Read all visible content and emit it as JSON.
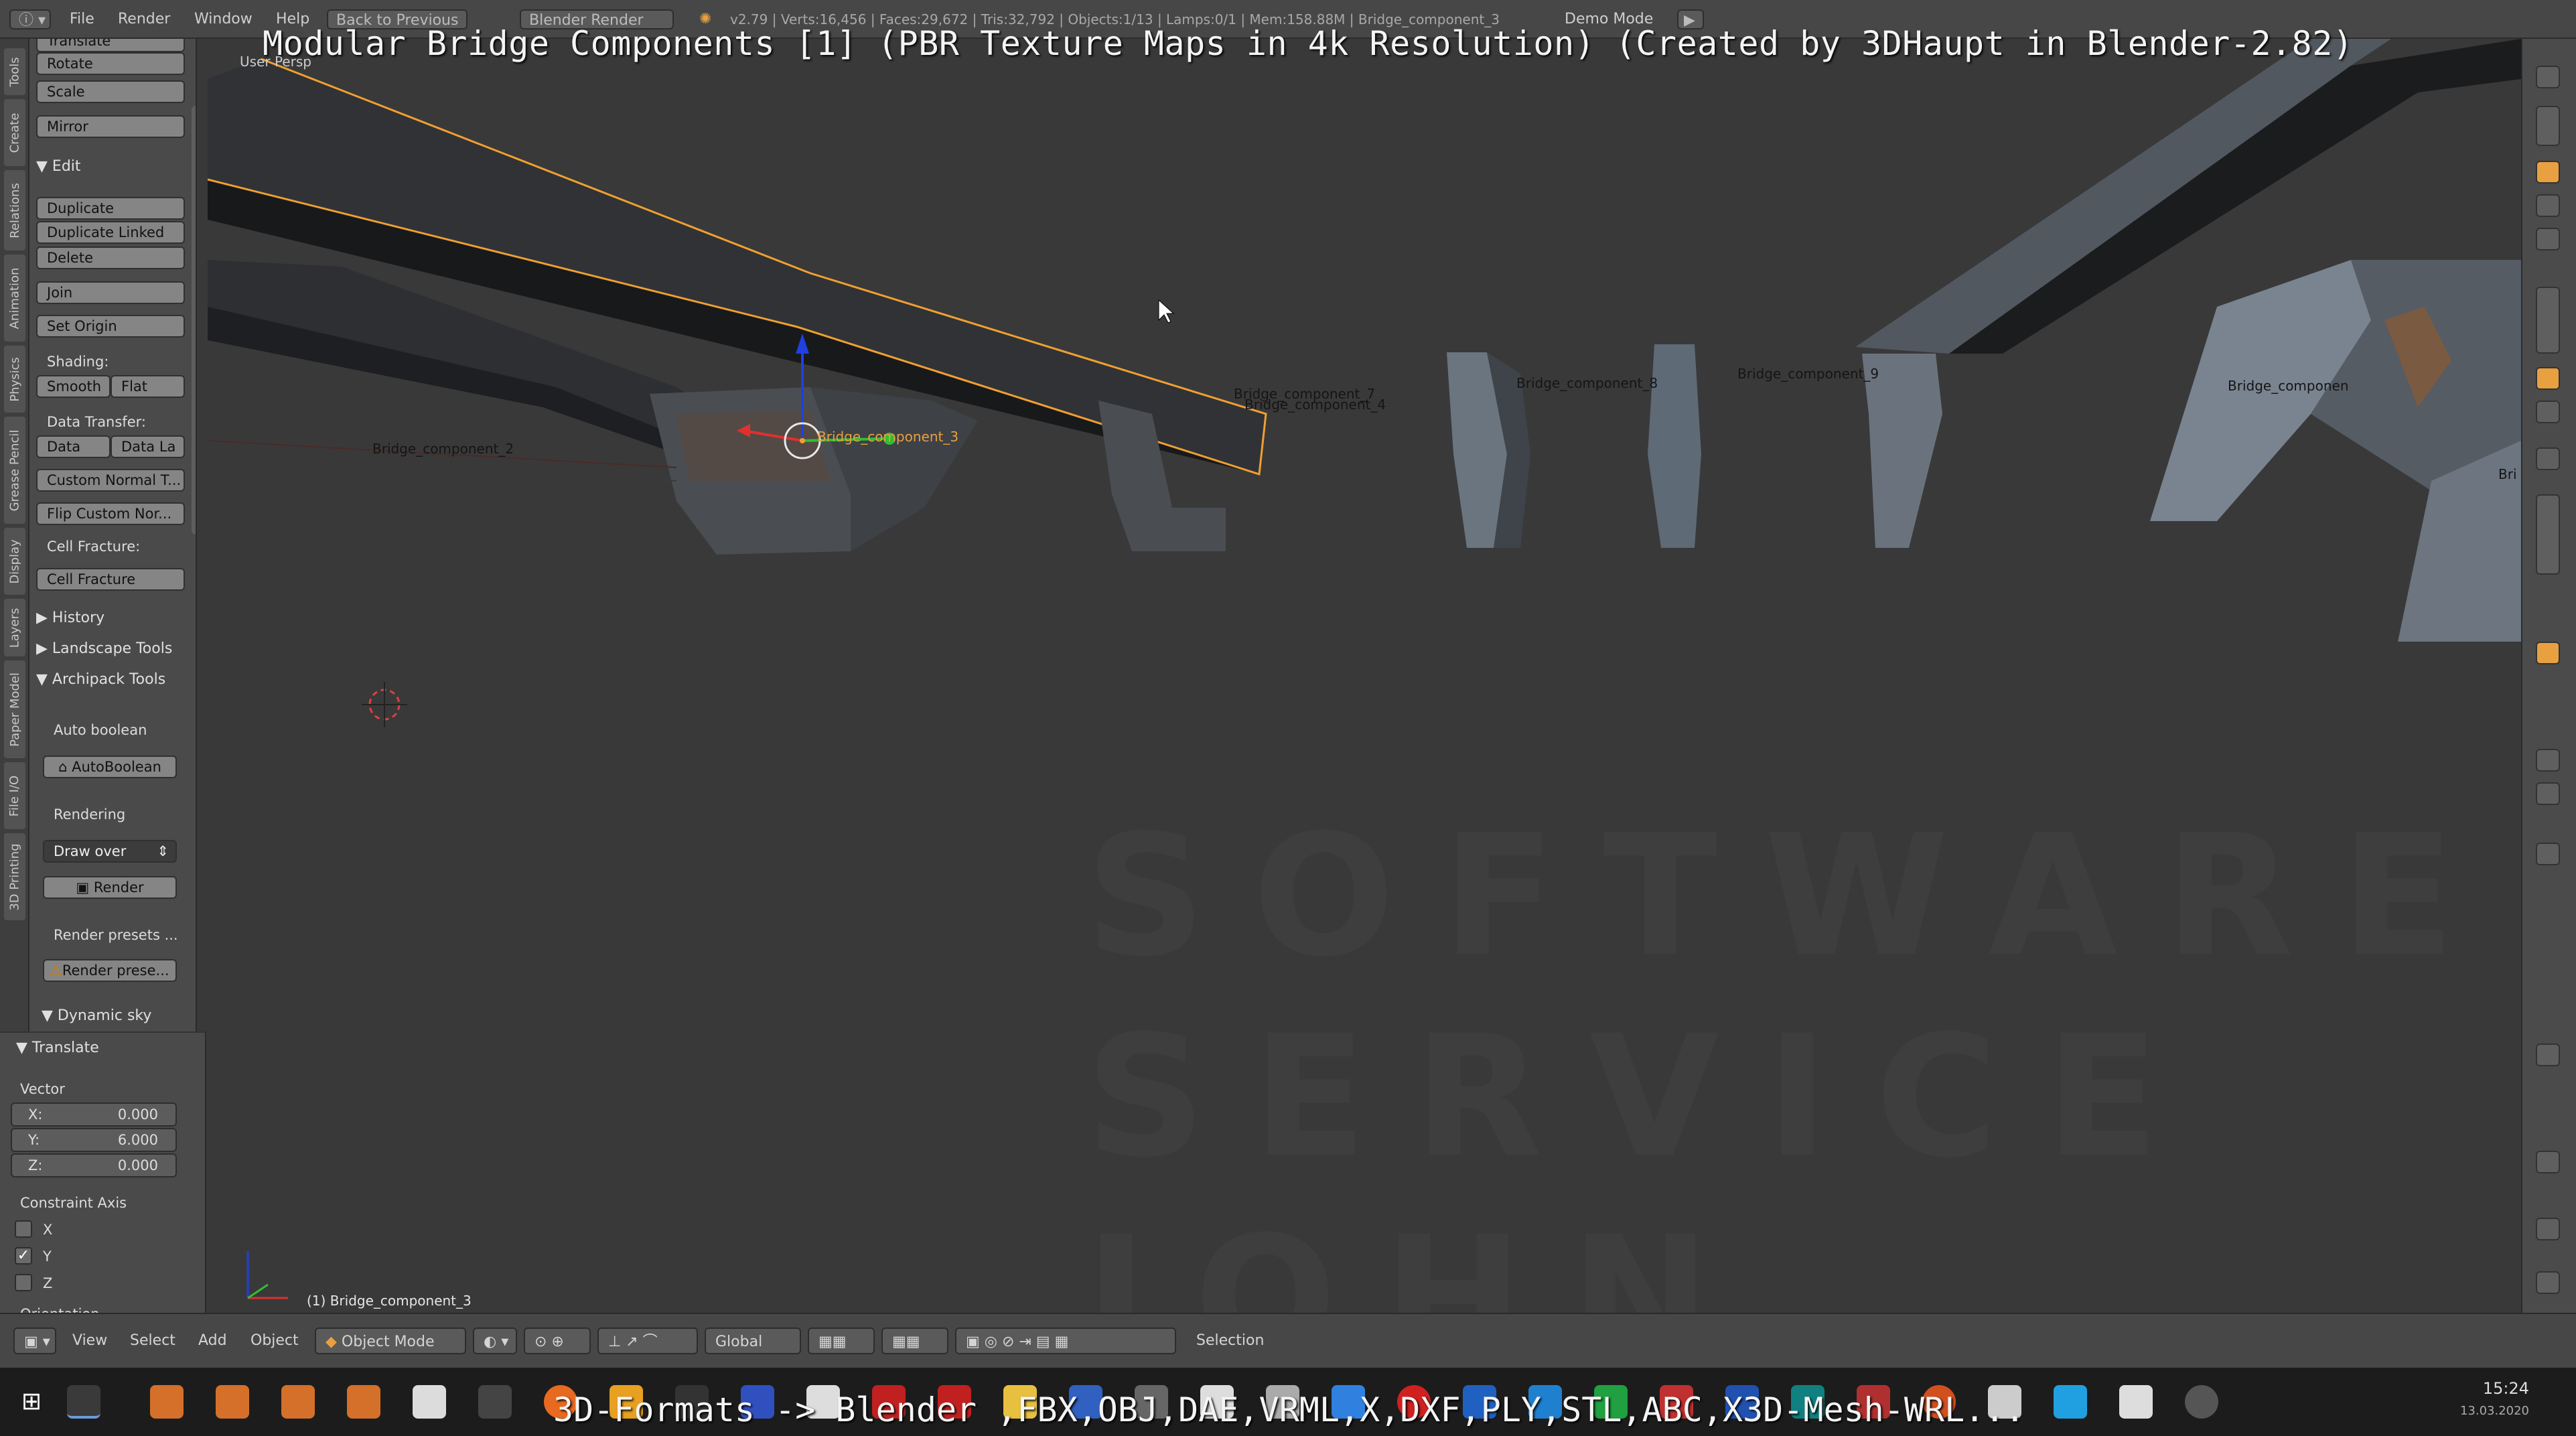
{
  "overlay": {
    "title": "Modular Bridge Components [1] (PBR Texture Maps in 4k Resolution) (Created by 3DHaupt in Blender-2.82)",
    "subtitle": "3D-Formats -> Blender ,FBX,OBJ,DAE,VRML,X,DXF,PLY,STL,ABC,X3D-Mesh-WRL..."
  },
  "topbar": {
    "menus": [
      "File",
      "Render",
      "Window",
      "Help"
    ],
    "back_to_previous": "Back to Previous",
    "render_engine": "Blender Render",
    "info": "v2.79 | Verts:16,456 | Faces:29,672 | Tris:32,792 | Objects:1/13 | Lamps:0/1 | Mem:158.88M | Bridge_component_3",
    "demo_mode": "Demo Mode"
  },
  "vertical_tabs": [
    "Tools",
    "Create",
    "Relations",
    "Animation",
    "Physics",
    "Grease Pencil",
    "Display",
    "Layers",
    "Paper Model",
    "File I/O",
    "3D Printing"
  ],
  "toolshelf": {
    "transform_partial": "Translate",
    "rotate": "Rotate",
    "scale": "Scale",
    "mirror": "Mirror",
    "edit_header": "Edit",
    "duplicate": "Duplicate",
    "duplicate_linked": "Duplicate Linked",
    "delete": "Delete",
    "join": "Join",
    "set_origin": "Set Origin",
    "shading_label": "Shading:",
    "smooth": "Smooth",
    "flat": "Flat",
    "data_transfer_label": "Data Transfer:",
    "data": "Data",
    "data_layout": "Data La",
    "custom_normal": "Custom Normal T...",
    "flip_custom_normals": "Flip Custom Nor...",
    "cell_fracture_label": "Cell Fracture:",
    "cell_fracture": "Cell Fracture",
    "history": "History",
    "landscape_tools": "Landscape Tools",
    "archipack_tools": "Archipack Tools",
    "auto_boolean_label": "Auto boolean",
    "auto_boolean_btn": "AutoBoolean",
    "rendering_label": "Rendering",
    "draw_over": "Draw over",
    "render_btn": "Render",
    "render_presets_label": "Render presets ...",
    "render_presets_btn": "Render prese...",
    "dynamic_sky": "Dynamic sky"
  },
  "redo_panel": {
    "header": "Translate",
    "vector_label": "Vector",
    "x_label": "X:",
    "x_value": "0.000",
    "y_label": "Y:",
    "y_value": "6.000",
    "z_label": "Z:",
    "z_value": "0.000",
    "constraint_label": "Constraint Axis",
    "cx": "X",
    "cy": "Y",
    "cz": "Z",
    "y_checked": true,
    "orientation_label": "Orientation"
  },
  "viewport": {
    "view_label": "User Persp",
    "selected_object": "(1) Bridge_component_3",
    "object_labels": {
      "c2": "Bridge_component_2",
      "c3": "Bridge_component_3",
      "c7": "Bridge_component_7",
      "c4": "Bridge_component_4",
      "c8": "Bridge_component_8",
      "c9": "Bridge_component_9",
      "cx": "Bridge_componen",
      "cy": "Bri"
    },
    "watermark_lines": [
      "SOFTWARE",
      "SERVICE",
      "JOHN"
    ],
    "selection_color": "#f0a030",
    "axis_x_color": "#e03030",
    "axis_y_color": "#30c030",
    "axis_z_color": "#2040e0"
  },
  "statusbar": {
    "view": "View",
    "select": "Select",
    "add": "Add",
    "object": "Object",
    "mode": "Object Mode",
    "orientation": "Global",
    "selection": "Selection"
  },
  "taskbar": {
    "time": "15:24",
    "date": "13.03.2020"
  }
}
